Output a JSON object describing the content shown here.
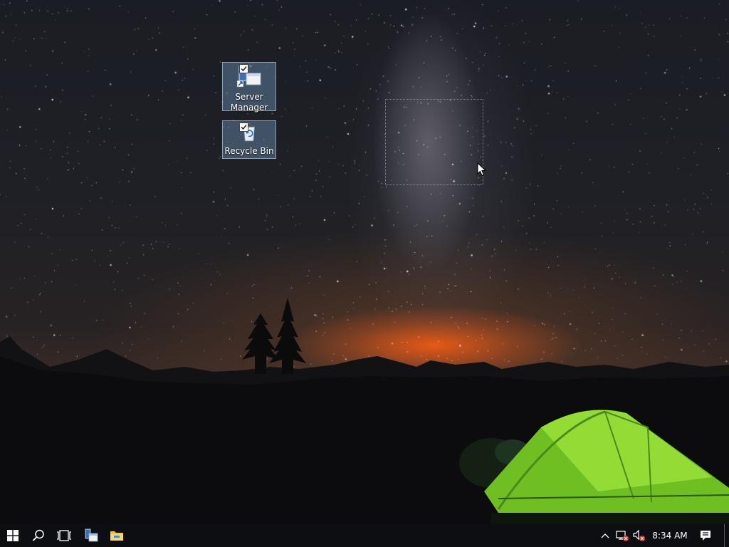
{
  "desktop": {
    "icons": [
      {
        "label_line1": "Server",
        "label_line2": "Manager",
        "icon": "server-manager-icon",
        "selected": true
      },
      {
        "label_line1": "Recycle Bin",
        "icon": "recycle-bin-icon",
        "selected": true
      }
    ],
    "selection_checkboxes": "checked"
  },
  "taskbar": {
    "start_icon": "windows-logo-icon",
    "search_icon": "search-icon",
    "task_view_icon": "task-view-icon",
    "pinned": [
      {
        "icon": "server-manager-icon"
      },
      {
        "icon": "file-explorer-icon"
      }
    ],
    "tray": {
      "chevron_icon": "chevron-up-icon",
      "network_icon": "network-disconnected-icon",
      "volume_icon": "volume-muted-icon",
      "time": "8:34 AM",
      "action_center_icon": "action-center-icon"
    }
  },
  "colors": {
    "taskbar_bg": "#0d0e12",
    "icon_selection_bg": "#7aa0c8",
    "tent_green": "#7ed321",
    "horizon_glow": "#ff5f14",
    "tray_error_red": "#e03030"
  }
}
